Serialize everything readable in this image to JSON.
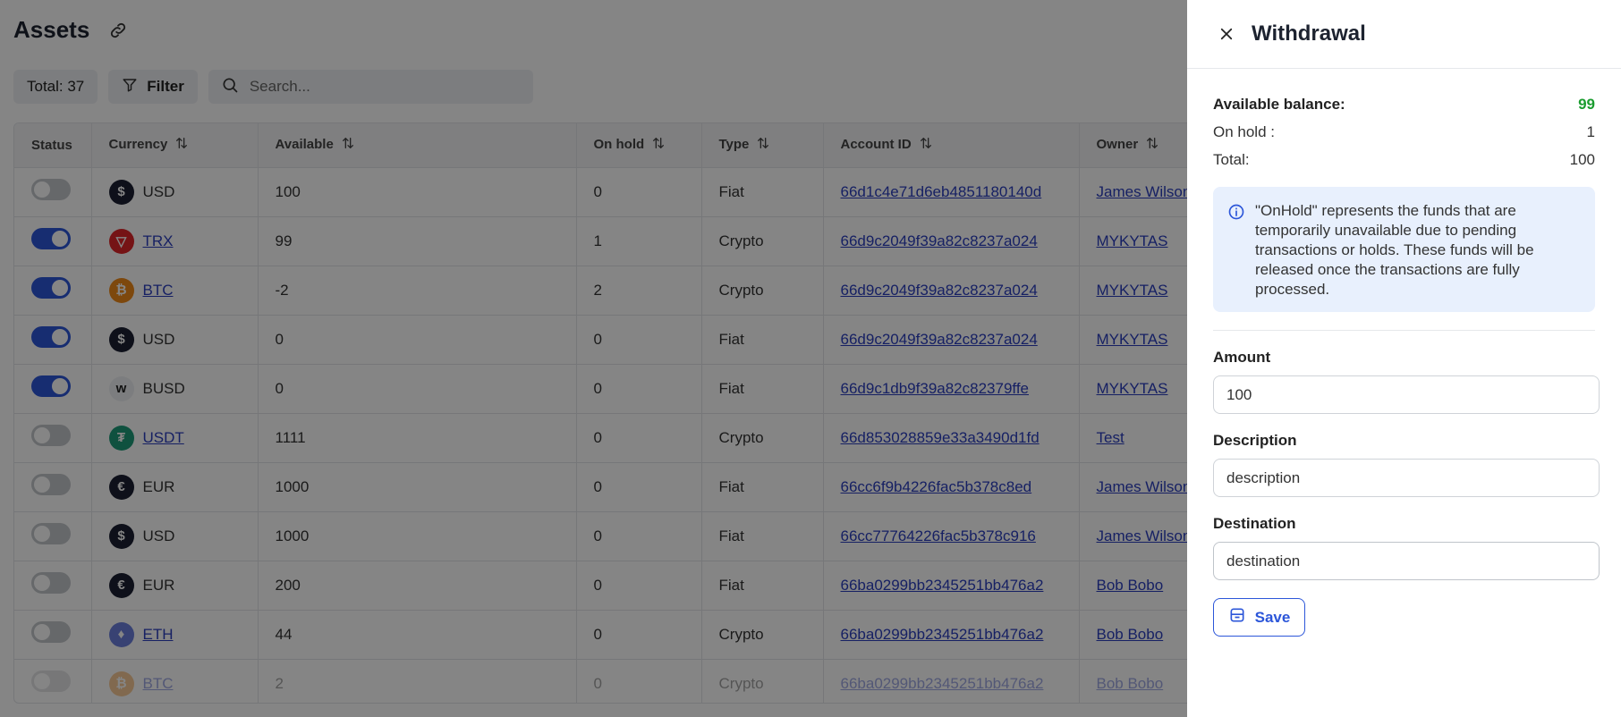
{
  "page": {
    "title": "Assets",
    "total_label": "Total: 37",
    "filter_label": "Filter",
    "search_placeholder": "Search..."
  },
  "table": {
    "columns": [
      "Status",
      "Currency",
      "Available",
      "On hold",
      "Type",
      "Account ID",
      "Owner"
    ],
    "rows": [
      {
        "status_on": false,
        "currency": "USD",
        "currency_link": false,
        "icon": "dollar-icon",
        "available": "100",
        "on_hold": "0",
        "type": "Fiat",
        "account_id": "66d1c4e71d6eb4851180140d",
        "owner": "James Wilson"
      },
      {
        "status_on": true,
        "currency": "TRX",
        "currency_link": true,
        "icon": "tron-icon",
        "available": "99",
        "on_hold": "1",
        "type": "Crypto",
        "account_id": "66d9c2049f39a82c8237a024",
        "owner": "MYKYTAS"
      },
      {
        "status_on": true,
        "currency": "BTC",
        "currency_link": true,
        "icon": "bitcoin-icon",
        "available": "-2",
        "on_hold": "2",
        "type": "Crypto",
        "account_id": "66d9c2049f39a82c8237a024",
        "owner": "MYKYTAS"
      },
      {
        "status_on": true,
        "currency": "USD",
        "currency_link": false,
        "icon": "dollar-icon",
        "available": "0",
        "on_hold": "0",
        "type": "Fiat",
        "account_id": "66d9c2049f39a82c8237a024",
        "owner": "MYKYTAS"
      },
      {
        "status_on": true,
        "currency": "BUSD",
        "currency_link": false,
        "icon": "busd-icon",
        "available": "0",
        "on_hold": "0",
        "type": "Fiat",
        "account_id": "66d9c1db9f39a82c82379ffe",
        "owner": "MYKYTAS"
      },
      {
        "status_on": false,
        "currency": "USDT",
        "currency_link": true,
        "icon": "tether-icon",
        "available": "1111",
        "on_hold": "0",
        "type": "Crypto",
        "account_id": "66d853028859e33a3490d1fd",
        "owner": "Test"
      },
      {
        "status_on": false,
        "currency": "EUR",
        "currency_link": false,
        "icon": "euro-icon",
        "available": "1000",
        "on_hold": "0",
        "type": "Fiat",
        "account_id": "66cc6f9b4226fac5b378c8ed",
        "owner": "James Wilson"
      },
      {
        "status_on": false,
        "currency": "USD",
        "currency_link": false,
        "icon": "dollar-icon",
        "available": "1000",
        "on_hold": "0",
        "type": "Fiat",
        "account_id": "66cc77764226fac5b378c916",
        "owner": "James Wilson"
      },
      {
        "status_on": false,
        "currency": "EUR",
        "currency_link": false,
        "icon": "euro-icon",
        "available": "200",
        "on_hold": "0",
        "type": "Fiat",
        "account_id": "66ba0299bb2345251bb476a2",
        "owner": "Bob Bobo"
      },
      {
        "status_on": false,
        "currency": "ETH",
        "currency_link": true,
        "icon": "ethereum-icon",
        "available": "44",
        "on_hold": "0",
        "type": "Crypto",
        "account_id": "66ba0299bb2345251bb476a2",
        "owner": "Bob Bobo"
      },
      {
        "status_on": false,
        "currency": "BTC",
        "currency_link": true,
        "icon": "bitcoin-icon",
        "available": "2",
        "on_hold": "0",
        "type": "Crypto",
        "account_id": "66ba0299bb2345251bb476a2",
        "owner": "Bob Bobo"
      }
    ]
  },
  "drawer": {
    "title": "Withdrawal",
    "available_label": "Available balance:",
    "available_value": "99",
    "on_hold_label": "On hold :",
    "on_hold_value": "1",
    "total_label": "Total:",
    "total_value": "100",
    "info_text": "\"OnHold\" represents the funds that are temporarily unavailable due to pending transactions or holds. These funds will be released once the transactions are fully processed.",
    "amount_label": "Amount",
    "amount_value": "100",
    "description_label": "Description",
    "description_value": "description",
    "destination_label": "Destination",
    "destination_value": "destination",
    "save_label": "Save"
  },
  "colors": {
    "accent": "#2c56d9",
    "positive": "#1a9c2f",
    "info_bg": "#e8f0fd",
    "link": "#2b3fbf"
  }
}
